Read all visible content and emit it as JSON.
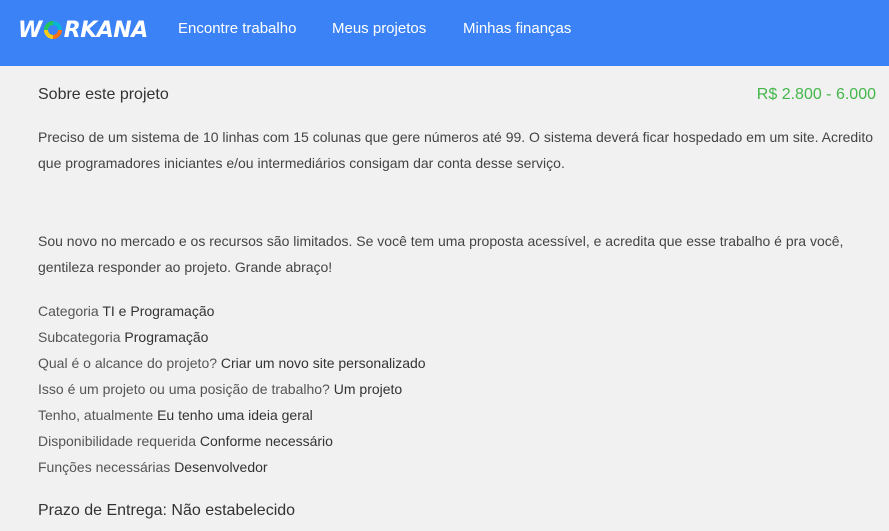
{
  "header": {
    "logo_text_prefix": "W",
    "logo_text_suffix": "RKANA",
    "nav": [
      {
        "label": "Encontre trabalho"
      },
      {
        "label": "Meus projetos"
      },
      {
        "label": "Minhas finanças"
      }
    ],
    "colors": {
      "bar": "#3b82f6",
      "logo_ring": [
        "#f97316",
        "#facc15",
        "#22c55e",
        "#06b6d4"
      ]
    }
  },
  "project": {
    "section_title": "Sobre este projeto",
    "budget": "R$ 2.800 - 6.000",
    "budget_color": "#43b649",
    "description_1": "Preciso de um sistema de 10 linhas com 15 colunas que gere números até 99. O sistema deverá ficar hospedado em um site. Acredito que programadores iniciantes e/ou intermediários consigam dar conta desse serviço.",
    "description_2": "Sou novo no mercado e os recursos são limitados. Se você tem uma proposta acessível, e acredita que esse trabalho é pra você, gentileza responder ao projeto. Grande abraço!",
    "details": [
      {
        "label": "Categoria",
        "value": "TI e Programação"
      },
      {
        "label": "Subcategoria",
        "value": "Programação"
      },
      {
        "label": "Qual é o alcance do projeto?",
        "value": "Criar um novo site personalizado"
      },
      {
        "label": "Isso é um projeto ou uma posição de trabalho?",
        "value": "Um projeto"
      },
      {
        "label": "Tenho, atualmente",
        "value": "Eu tenho uma ideia geral"
      },
      {
        "label": "Disponibilidade requerida",
        "value": "Conforme necessário"
      },
      {
        "label": "Funções necessárias",
        "value": "Desenvolvedor"
      }
    ],
    "deadline": "Prazo de Entrega: Não estabelecido"
  }
}
